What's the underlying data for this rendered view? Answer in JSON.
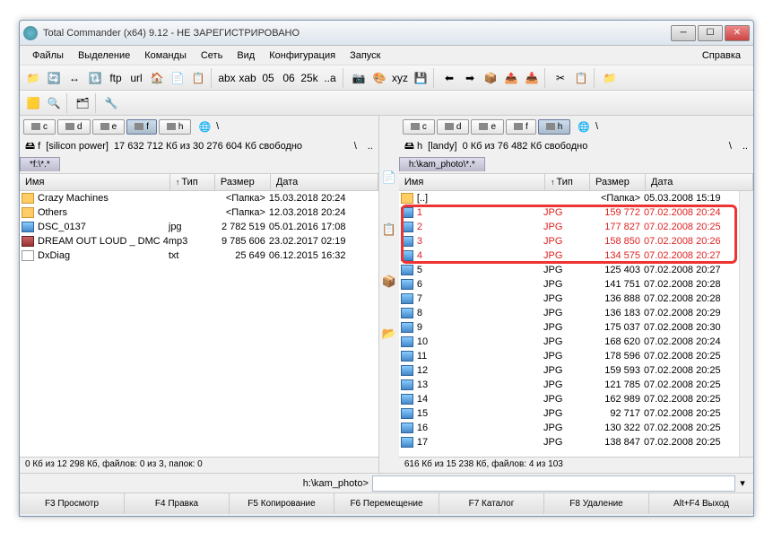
{
  "title": "Total Commander (x64) 9.12 - НЕ ЗАРЕГИСТРИРОВАНО",
  "menu": {
    "files": "Файлы",
    "selection": "Выделение",
    "commands": "Команды",
    "net": "Сеть",
    "view": "Вид",
    "config": "Конфигурация",
    "start": "Запуск",
    "help": "Справка"
  },
  "toolbar_icons": [
    "📁",
    "🔄",
    "↔",
    "🔃",
    "ftp",
    "url",
    "🏠",
    "📄",
    "📋",
    "|",
    "abx",
    "xab",
    "05",
    "06",
    "25k",
    "..a",
    "|",
    "📷",
    "🎨",
    "xyz",
    "💾",
    "|",
    "⬅",
    "➡",
    "📦",
    "📤",
    "📥",
    "|",
    "✂",
    "📋",
    "|",
    "📁"
  ],
  "toolbar2_icons": [
    "🟨",
    "🔍",
    "|",
    "🗂",
    "|",
    "🔧"
  ],
  "drives": [
    "c",
    "d",
    "e",
    "f",
    "h"
  ],
  "globe": "🌐",
  "left": {
    "active_drive": "f",
    "info_drive": "f",
    "info_label": "[silicon power]",
    "info_space": "17 632 712 Кб из 30 276 604 Кб свободно",
    "slash": "\\",
    "dots": "..",
    "tab": "*f:\\*.*",
    "headers": {
      "name": "Имя",
      "type": "Тип",
      "size": "Размер",
      "date": "Дата"
    },
    "files": [
      {
        "name": "Crazy Machines",
        "type": "",
        "size": "<Папка>",
        "date": "15.03.2018 20:24",
        "icon": "folder"
      },
      {
        "name": "Others",
        "type": "",
        "size": "<Папка>",
        "date": "12.03.2018 20:24",
        "icon": "folder"
      },
      {
        "name": "DSC_0137",
        "type": "jpg",
        "size": "2 782 519",
        "date": "05.01.2016 17:08",
        "icon": "jpg"
      },
      {
        "name": "DREAM OUT LOUD _ DMC 4",
        "type": "mp3",
        "size": "9 785 606",
        "date": "23.02.2017 02:19",
        "icon": "mp3"
      },
      {
        "name": "DxDiag",
        "type": "txt",
        "size": "25 649",
        "date": "06.12.2015 16:32",
        "icon": "txt"
      }
    ],
    "status": "0 Кб из 12 298 Кб, файлов: 0 из 3, папок: 0"
  },
  "right": {
    "active_drive": "h",
    "info_drive": "h",
    "info_label": "[landy]",
    "info_space": "0 Кб из 76 482 Кб свободно",
    "slash": "\\",
    "dots": "..",
    "tab": "h:\\kam_photo\\*.*",
    "headers": {
      "name": "Имя",
      "type": "Тип",
      "size": "Размер",
      "date": "Дата"
    },
    "files": [
      {
        "name": "[..]",
        "type": "",
        "size": "<Папка>",
        "date": "05.03.2008 15:19",
        "icon": "folder",
        "up": true
      },
      {
        "name": "1",
        "type": "JPG",
        "size": "159 772",
        "date": "07.02.2008 20:24",
        "icon": "jpg",
        "sel": true
      },
      {
        "name": "2",
        "type": "JPG",
        "size": "177 827",
        "date": "07.02.2008 20:25",
        "icon": "jpg",
        "sel": true
      },
      {
        "name": "3",
        "type": "JPG",
        "size": "158 850",
        "date": "07.02.2008 20:26",
        "icon": "jpg",
        "sel": true
      },
      {
        "name": "4",
        "type": "JPG",
        "size": "134 575",
        "date": "07.02.2008 20:27",
        "icon": "jpg",
        "sel": true
      },
      {
        "name": "5",
        "type": "JPG",
        "size": "125 403",
        "date": "07.02.2008 20:27",
        "icon": "jpg"
      },
      {
        "name": "6",
        "type": "JPG",
        "size": "141 751",
        "date": "07.02.2008 20:28",
        "icon": "jpg"
      },
      {
        "name": "7",
        "type": "JPG",
        "size": "136 888",
        "date": "07.02.2008 20:28",
        "icon": "jpg"
      },
      {
        "name": "8",
        "type": "JPG",
        "size": "136 183",
        "date": "07.02.2008 20:29",
        "icon": "jpg"
      },
      {
        "name": "9",
        "type": "JPG",
        "size": "175 037",
        "date": "07.02.2008 20:30",
        "icon": "jpg"
      },
      {
        "name": "10",
        "type": "JPG",
        "size": "168 620",
        "date": "07.02.2008 20:24",
        "icon": "jpg"
      },
      {
        "name": "11",
        "type": "JPG",
        "size": "178 596",
        "date": "07.02.2008 20:25",
        "icon": "jpg"
      },
      {
        "name": "12",
        "type": "JPG",
        "size": "159 593",
        "date": "07.02.2008 20:25",
        "icon": "jpg"
      },
      {
        "name": "13",
        "type": "JPG",
        "size": "121 785",
        "date": "07.02.2008 20:25",
        "icon": "jpg"
      },
      {
        "name": "14",
        "type": "JPG",
        "size": "162 989",
        "date": "07.02.2008 20:25",
        "icon": "jpg"
      },
      {
        "name": "15",
        "type": "JPG",
        "size": "92 717",
        "date": "07.02.2008 20:25",
        "icon": "jpg"
      },
      {
        "name": "16",
        "type": "JPG",
        "size": "130 322",
        "date": "07.02.2008 20:25",
        "icon": "jpg"
      },
      {
        "name": "17",
        "type": "JPG",
        "size": "138 847",
        "date": "07.02.2008 20:25",
        "icon": "jpg"
      }
    ],
    "status": "616 Кб из 15 238 Кб, файлов: 4 из 103"
  },
  "cmdline_label": "h:\\kam_photo>",
  "fnbar": {
    "f3": "F3 Просмотр",
    "f4": "F4 Правка",
    "f5": "F5 Копирование",
    "f6": "F6 Перемещение",
    "f7": "F7 Каталог",
    "f8": "F8 Удаление",
    "altf4": "Alt+F4 Выход"
  },
  "mid_icons": [
    "📄",
    "📋",
    "📦",
    "📂"
  ]
}
